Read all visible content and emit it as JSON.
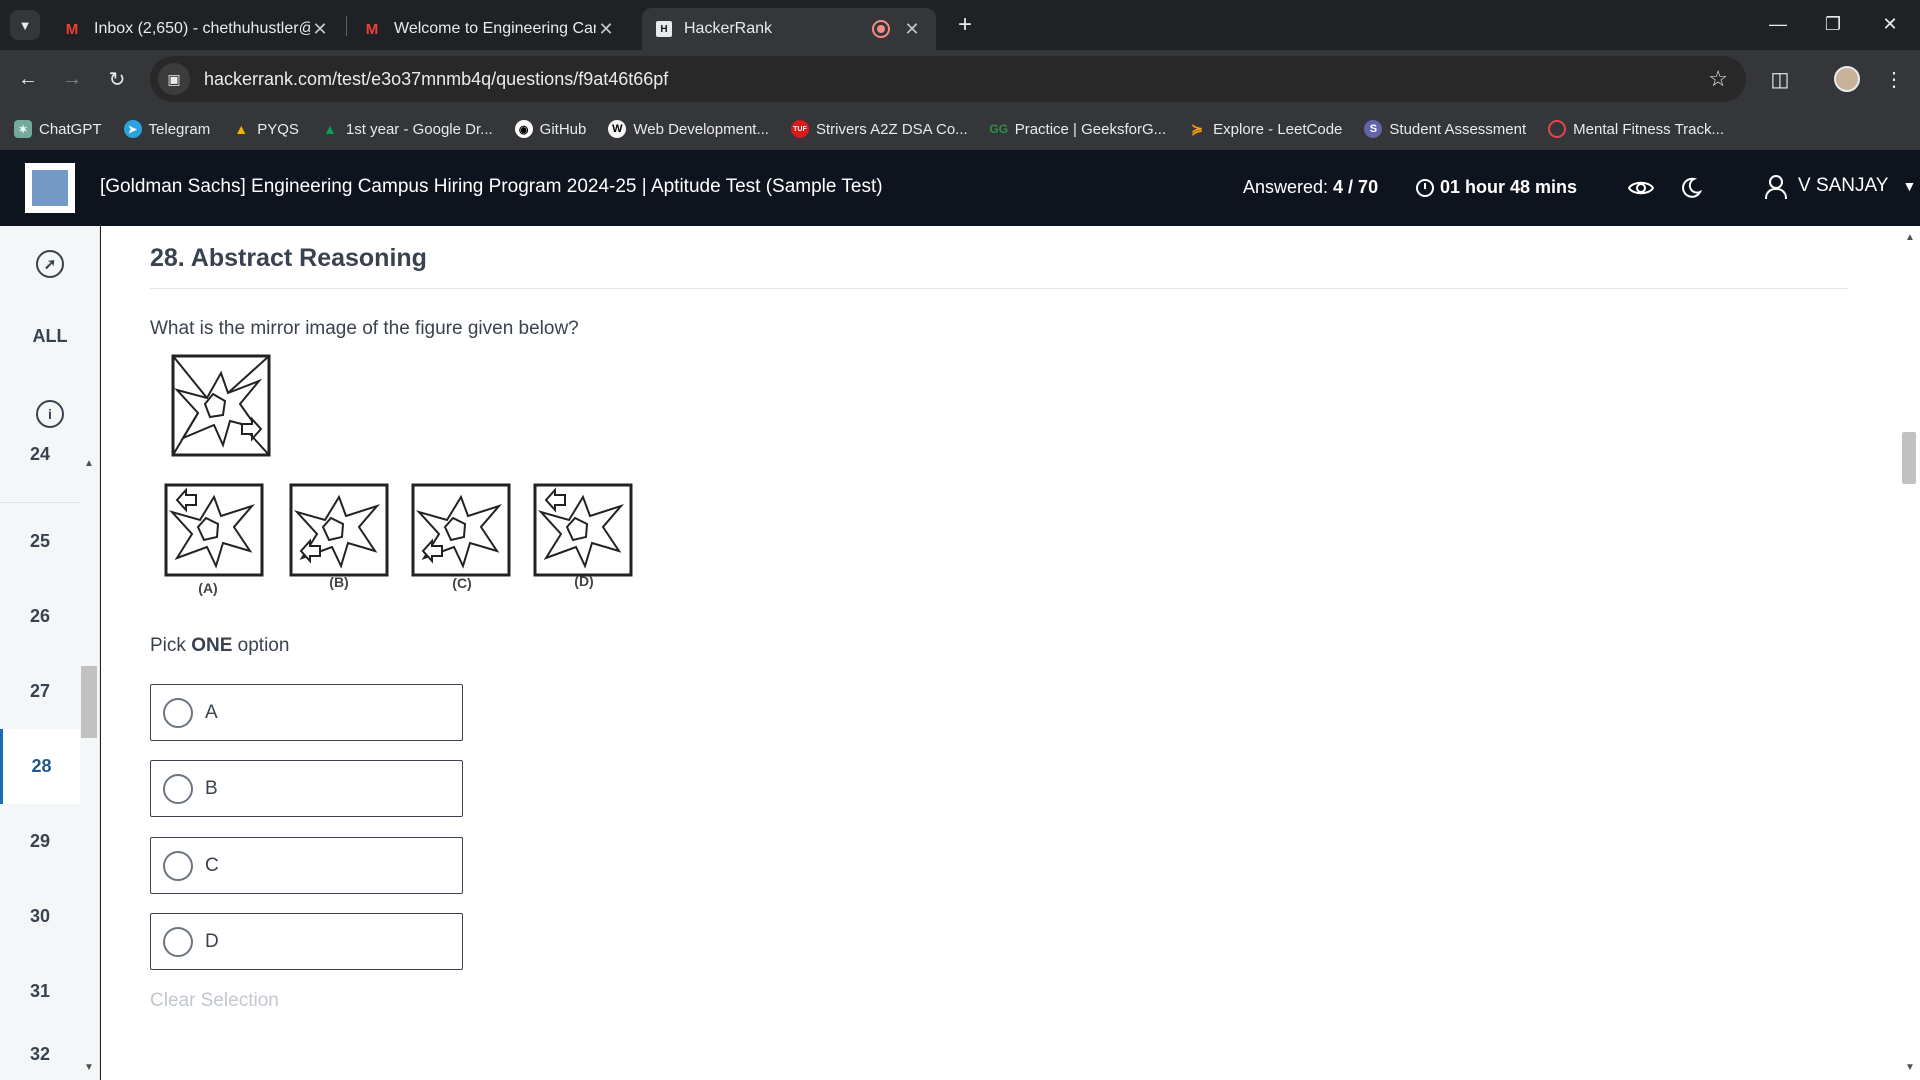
{
  "browser": {
    "tabs": [
      {
        "title": "Inbox (2,650) - chethuhustler@",
        "icon": "gmail-icon"
      },
      {
        "title": "Welcome to Engineering Camp",
        "icon": "gmail-icon"
      },
      {
        "title": "HackerRank",
        "icon": "hackerrank-icon",
        "active": true
      }
    ],
    "url": "hackerrank.com/test/e3o37mnmb4q/questions/f9at46t66pf",
    "bookmarks": [
      {
        "label": "ChatGPT",
        "color": "#74aa9c"
      },
      {
        "label": "Telegram",
        "color": "#2aa3df"
      },
      {
        "label": "PYQS",
        "color": "#f4b400"
      },
      {
        "label": "1st year - Google Dr...",
        "color": "#0f9d58"
      },
      {
        "label": "GitHub",
        "color": "#ffffff"
      },
      {
        "label": "Web Development...",
        "color": "#f0c000"
      },
      {
        "label": "Strivers A2Z DSA Co...",
        "color": "#d81b1b"
      },
      {
        "label": "Practice | GeeksforG...",
        "color": "#2f8d46"
      },
      {
        "label": "Explore - LeetCode",
        "color": "#ffa116"
      },
      {
        "label": "Student Assessment",
        "color": "#6264a7"
      },
      {
        "label": "Mental Fitness Track...",
        "color": "#e0474c"
      }
    ]
  },
  "header": {
    "test_title": "[Goldman Sachs] Engineering Campus Hiring Program 2024-25 | Aptitude Test (Sample Test)",
    "answered_label": "Answered: ",
    "answered_value": "4 / 70",
    "timer": "01 hour 48 mins",
    "user": "V SANJAY"
  },
  "sidebar": {
    "all_label": "ALL",
    "questions": [
      "24",
      "25",
      "26",
      "27",
      "28",
      "29",
      "30",
      "31",
      "32"
    ],
    "active": "28"
  },
  "question": {
    "title": "28. Abstract Reasoning",
    "text": "What is the mirror image of the figure given below?",
    "pick_prefix": "Pick ",
    "pick_bold": "ONE",
    "pick_suffix": " option",
    "options": [
      "A",
      "B",
      "C",
      "D"
    ],
    "figure_labels": [
      "(A)",
      "(B)",
      "(C)",
      "(D)"
    ],
    "clear_label": "Clear Selection"
  },
  "colors": {
    "header_bg": "#0e141e",
    "sidebar_bg": "#f3f7f7",
    "active_blue": "#1c6bb8",
    "text": "#39424e"
  }
}
